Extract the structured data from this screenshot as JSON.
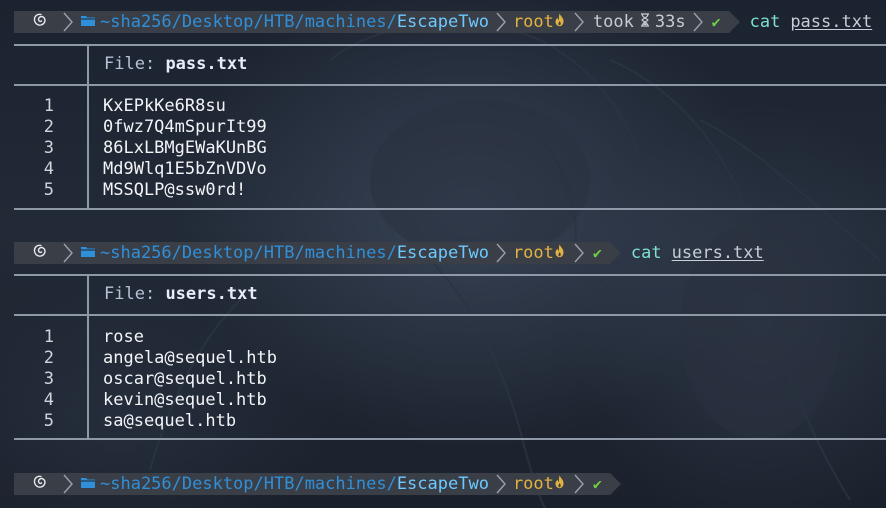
{
  "colors": {
    "path_dim": "#2f8fd9",
    "path_highlight": "#6cc8ff",
    "user": "#e3b341",
    "command": "#7ee0d0",
    "check": "#6fcf45",
    "segment_bg": "#3a3f47",
    "rule": "#8f98a6"
  },
  "prompts": [
    {
      "os_icon": "debian-swirl-icon",
      "folder_icon": "folder-icon",
      "path_prefix": "~sha256/Desktop/HTB/machines/",
      "path_current": "EscapeTwo",
      "user": "root",
      "root_icon": "flame-icon",
      "took_label": "took",
      "took_icon": "hourglass-icon",
      "took_value": "33s",
      "status": "✔",
      "command": "cat",
      "argument": "pass.txt"
    },
    {
      "os_icon": "debian-swirl-icon",
      "folder_icon": "folder-icon",
      "path_prefix": "~sha256/Desktop/HTB/machines/",
      "path_current": "EscapeTwo",
      "user": "root",
      "root_icon": "flame-icon",
      "status": "✔",
      "command": "cat",
      "argument": "users.txt"
    },
    {
      "os_icon": "debian-swirl-icon",
      "folder_icon": "folder-icon",
      "path_prefix": "~sha256/Desktop/HTB/machines/",
      "path_current": "EscapeTwo",
      "user": "root",
      "root_icon": "flame-icon",
      "status": "✔"
    }
  ],
  "outputs": [
    {
      "file_label": "File:",
      "file_name": "pass.txt",
      "lines": [
        {
          "n": "1",
          "text": "KxEPkKe6R8su"
        },
        {
          "n": "2",
          "text": "0fwz7Q4mSpurIt99"
        },
        {
          "n": "3",
          "text": "86LxLBMgEWaKUnBG"
        },
        {
          "n": "4",
          "text": "Md9Wlq1E5bZnVDVo"
        },
        {
          "n": "5",
          "text": "MSSQLP@ssw0rd!"
        }
      ]
    },
    {
      "file_label": "File:",
      "file_name": "users.txt",
      "lines": [
        {
          "n": "1",
          "text": "rose"
        },
        {
          "n": "2",
          "text": "angela@sequel.htb"
        },
        {
          "n": "3",
          "text": "oscar@sequel.htb"
        },
        {
          "n": "4",
          "text": "kevin@sequel.htb"
        },
        {
          "n": "5",
          "text": "sa@sequel.htb"
        }
      ]
    }
  ]
}
